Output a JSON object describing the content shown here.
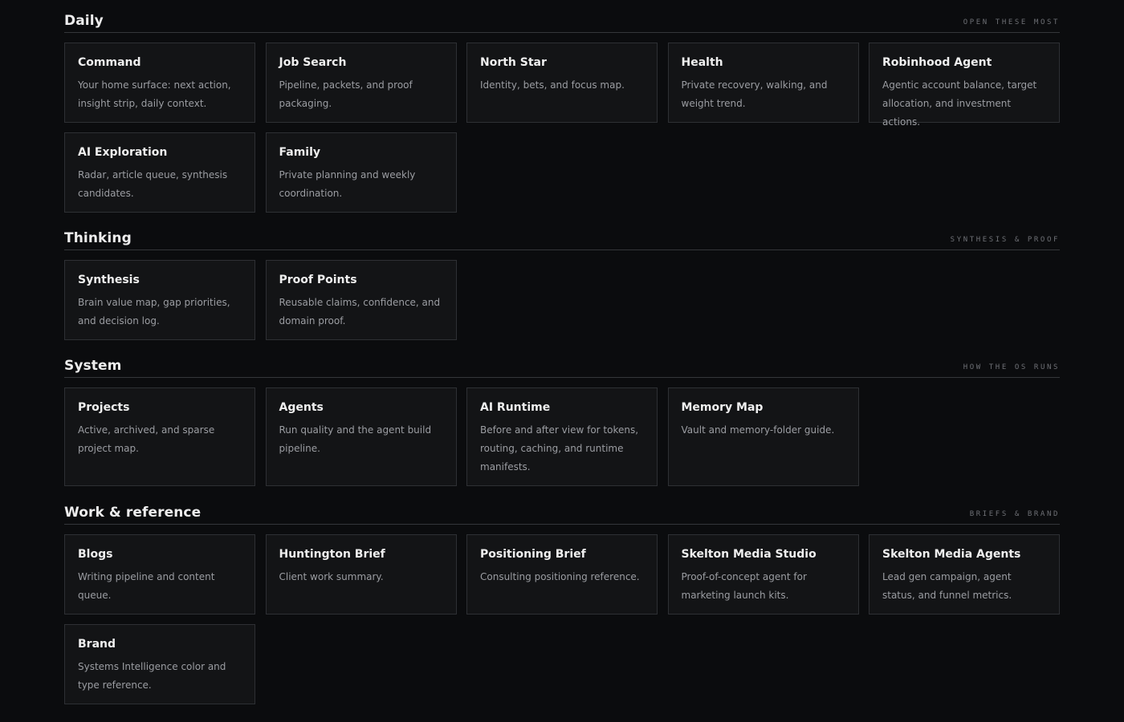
{
  "sections": [
    {
      "title": "Daily",
      "tag": "OPEN THESE MOST",
      "cards": [
        {
          "title": "Command",
          "desc": "Your home surface: next action, insight strip, daily context."
        },
        {
          "title": "Job Search",
          "desc": "Pipeline, packets, and proof packaging."
        },
        {
          "title": "North Star",
          "desc": "Identity, bets, and focus map."
        },
        {
          "title": "Health",
          "desc": "Private recovery, walking, and weight trend."
        },
        {
          "title": "Robinhood Agent",
          "desc": "Agentic account balance, target allocation, and investment actions."
        },
        {
          "title": "AI Exploration",
          "desc": "Radar, article queue, synthesis candidates."
        },
        {
          "title": "Family",
          "desc": "Private planning and weekly coordination."
        }
      ]
    },
    {
      "title": "Thinking",
      "tag": "SYNTHESIS & PROOF",
      "cards": [
        {
          "title": "Synthesis",
          "desc": "Brain value map, gap priorities, and decision log."
        },
        {
          "title": "Proof Points",
          "desc": "Reusable claims, confidence, and domain proof."
        }
      ]
    },
    {
      "title": "System",
      "tag": "HOW THE OS RUNS",
      "cards": [
        {
          "title": "Projects",
          "desc": "Active, archived, and sparse project map."
        },
        {
          "title": "Agents",
          "desc": "Run quality and the agent build pipeline."
        },
        {
          "title": "AI Runtime",
          "desc": "Before and after view for tokens, routing, caching, and runtime manifests."
        },
        {
          "title": "Memory Map",
          "desc": "Vault and memory-folder guide."
        }
      ]
    },
    {
      "title": "Work & reference",
      "tag": "BRIEFS & BRAND",
      "cards": [
        {
          "title": "Blogs",
          "desc": "Writing pipeline and content queue."
        },
        {
          "title": "Huntington Brief",
          "desc": "Client work summary."
        },
        {
          "title": "Positioning Brief",
          "desc": "Consulting positioning reference."
        },
        {
          "title": "Skelton Media Studio",
          "desc": "Proof-of-concept agent for marketing launch kits."
        },
        {
          "title": "Skelton Media Agents",
          "desc": "Lead gen campaign, agent status, and funnel metrics."
        },
        {
          "title": "Brand",
          "desc": "Systems Intelligence color and type reference."
        }
      ]
    }
  ]
}
